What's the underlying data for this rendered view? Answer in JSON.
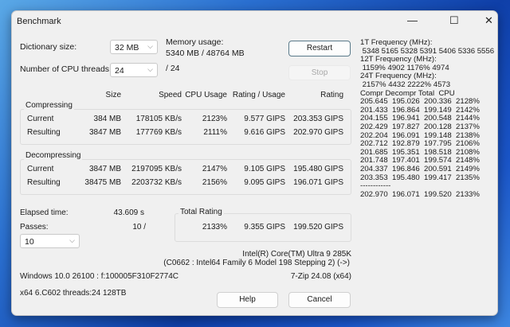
{
  "window": {
    "title": "Benchmark",
    "minimize": "—",
    "maximize": "☐",
    "close": "✕"
  },
  "settings": {
    "dictionary_label": "Dictionary size:",
    "dictionary_value": "32 MB",
    "threads_label": "Number of CPU threads:",
    "threads_value": "24",
    "threads_max": "/ 24",
    "memory_label": "Memory usage:",
    "memory_value": "5340 MB / 48764 MB"
  },
  "buttons": {
    "restart": "Restart",
    "stop": "Stop",
    "help": "Help",
    "cancel": "Cancel"
  },
  "columns": [
    "Size",
    "Speed",
    "CPU Usage",
    "Rating / Usage",
    "Rating"
  ],
  "compressing": {
    "label": "Compressing",
    "rows": [
      {
        "name": "Current",
        "size": "384 MB",
        "speed": "178105 KB/s",
        "cpu": "2123%",
        "rpu": "9.577 GIPS",
        "rating": "203.353 GIPS"
      },
      {
        "name": "Resulting",
        "size": "3847 MB",
        "speed": "177769 KB/s",
        "cpu": "2111%",
        "rpu": "9.616 GIPS",
        "rating": "202.970 GIPS"
      }
    ]
  },
  "decompressing": {
    "label": "Decompressing",
    "rows": [
      {
        "name": "Current",
        "size": "3847 MB",
        "speed": "2197095 KB/s",
        "cpu": "2147%",
        "rpu": "9.105 GIPS",
        "rating": "195.480 GIPS"
      },
      {
        "name": "Resulting",
        "size": "38475 MB",
        "speed": "2203732 KB/s",
        "cpu": "2156%",
        "rpu": "9.095 GIPS",
        "rating": "196.071 GIPS"
      }
    ]
  },
  "elapsed": {
    "label": "Elapsed time:",
    "value": "43.609 s"
  },
  "passes": {
    "label": "Passes:",
    "value": "10 /",
    "select": "10"
  },
  "total": {
    "label": "Total Rating",
    "cpu": "2133%",
    "rpu": "9.355 GIPS",
    "rating": "199.520 GIPS"
  },
  "cpu_info": {
    "name": "Intel(R) Core(TM) Ultra 9 285K",
    "detail": "(C0662 : Intel64 Family 6 Model 198 Stepping 2) (->)",
    "os": "Windows 10.0 26100 : f:100005F310F2774C",
    "version": "7-Zip 24.08 (x64)",
    "arch": "x64 6.C602 threads:24 128TB"
  },
  "right_panel": [
    "1T Frequency (MHz):",
    " 5348 5165 5328 5391 5406 5336 5556",
    "12T Frequency (MHz):",
    " 1159% 4902 1176% 4974",
    "24T Frequency (MHz):",
    " 2157% 4432 2222% 4573",
    "Compr Decompr Total  CPU",
    "205.645  195.026  200.336  2128%",
    "201.433  196.864  199.149  2142%",
    "204.155  196.941  200.548  2144%",
    "202.429  197.827  200.128  2137%",
    "202.204  196.091  199.148  2138%",
    "202.712  192.879  197.795  2106%",
    "201.685  195.351  198.518  2108%",
    "201.748  197.401  199.574  2148%",
    "204.337  196.846  200.591  2149%",
    "203.353  195.480  199.417  2135%",
    "------------",
    "202.970  196.071  199.520  2133%"
  ]
}
